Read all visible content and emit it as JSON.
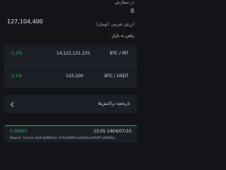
{
  "balance": {
    "label": "در سفارش",
    "value": "0"
  },
  "approx_value": {
    "label": "ارزش تقریبی (تومان)",
    "value": "127,104,400"
  },
  "market": {
    "title": "رفتن به بازار",
    "pairs": [
      {
        "pair": "BTC / IRT",
        "price": "14,121,121,231",
        "change": "1.2%"
      },
      {
        "pair": "BTC / USDT",
        "price": "123,100",
        "change": "1.1%"
      }
    ]
  },
  "history": {
    "label": "تاریخچه تراکنش‌ها"
  },
  "transaction": {
    "amount": "0.00901",
    "datetime": "13:05 1404/07/10",
    "detail": "Deposit - Invoice_hash:dj38KE2js~d7mlsDW0CmakljOGcoriEV6T-LXDd0tra"
  },
  "colors": {
    "background": "#121418",
    "card": "#1b1e24",
    "positive": "#2dbf6a"
  },
  "icons": {
    "chevron": "chevron-left-icon"
  }
}
